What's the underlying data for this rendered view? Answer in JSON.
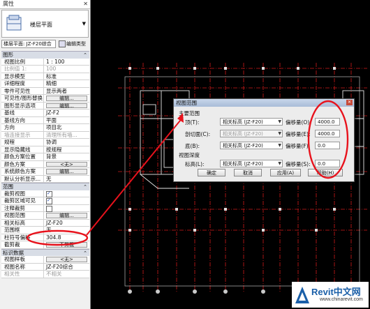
{
  "properties": {
    "title": "属性",
    "type_name": "楼层平面",
    "instance_selector": "楼层平面: JZ-F20综合",
    "edit_type_label": "编辑类型",
    "sections": [
      {
        "name": "图形",
        "rows": [
          {
            "k": "视图比例",
            "v": "1 : 100"
          },
          {
            "k": "比例值 1:",
            "v": "100",
            "grey": true
          },
          {
            "k": "显示模型",
            "v": "标准"
          },
          {
            "k": "详细程度",
            "v": "精细"
          },
          {
            "k": "零件可见性",
            "v": "显示两者"
          },
          {
            "k": "可见性/图形替换",
            "btn": "编辑..."
          },
          {
            "k": "图形显示选项",
            "btn": "编辑..."
          },
          {
            "k": "基线",
            "v": "JZ-F2"
          },
          {
            "k": "基线方向",
            "v": "平面"
          },
          {
            "k": "方向",
            "v": "项目北"
          },
          {
            "k": "墙连接显示",
            "v": "清理所有墙...",
            "grey": true
          },
          {
            "k": "规程",
            "v": "协调"
          },
          {
            "k": "显示隐藏线",
            "v": "按规程"
          },
          {
            "k": "颜色方案位置",
            "v": "背景"
          },
          {
            "k": "颜色方案",
            "btn": "<无>"
          },
          {
            "k": "系统颜色方案",
            "btn": "编辑..."
          },
          {
            "k": "默认分析显示...",
            "v": "无"
          }
        ]
      },
      {
        "name": "范围",
        "rows": [
          {
            "k": "裁剪视图",
            "chk": true
          },
          {
            "k": "裁剪区域可见",
            "chk": true
          },
          {
            "k": "注释裁剪",
            "chk": false
          },
          {
            "k": "视图范围",
            "btn": "编辑..."
          },
          {
            "k": "相关标高",
            "v": "JZ-F20"
          },
          {
            "k": "范围框",
            "v": "无"
          },
          {
            "k": "柱符号偏移",
            "v": "304.8"
          },
          {
            "k": "截剪裁",
            "btn": "不剪裁"
          }
        ]
      },
      {
        "name": "标识数据",
        "rows": [
          {
            "k": "视图样板",
            "btn": "<无>"
          },
          {
            "k": "视图名称",
            "v": "JZ-F20综合"
          },
          {
            "k": "相关性",
            "v": "不相关",
            "grey": true
          }
        ]
      }
    ]
  },
  "dialog": {
    "title": "视图范围",
    "primary_label": "主要范围",
    "depth_label": "视图深度",
    "offset_label": "偏移量",
    "rows": [
      {
        "label": "顶(T):",
        "combo": "相关标高 (JZ-F20)",
        "offset_key": "偏移量(O):",
        "value": "4000.0",
        "disabled": false
      },
      {
        "label": "剖切面(C):",
        "combo": "相关标高 (JZ-F20)",
        "offset_key": "偏移量(E):",
        "value": "4000.0",
        "disabled": true
      },
      {
        "label": "底(B):",
        "combo": "相关标高 (JZ-F20)",
        "offset_key": "偏移量(F):",
        "value": "0.0",
        "disabled": false
      },
      {
        "label": "标高(L):",
        "combo": "相关标高 (JZ-F20)",
        "offset_key": "偏移量(S):",
        "value": "0.0",
        "disabled": false
      }
    ],
    "buttons": {
      "ok": "确定",
      "cancel": "取消",
      "apply": "应用(A)",
      "help": "帮助(H)"
    }
  },
  "watermark": {
    "brand": "Revit中文网",
    "site": "www.chinarevit.com"
  },
  "colors": {
    "annotation": "#e8121c",
    "grid": "#d01a1a",
    "dialog_title": "#b7c9e2"
  }
}
